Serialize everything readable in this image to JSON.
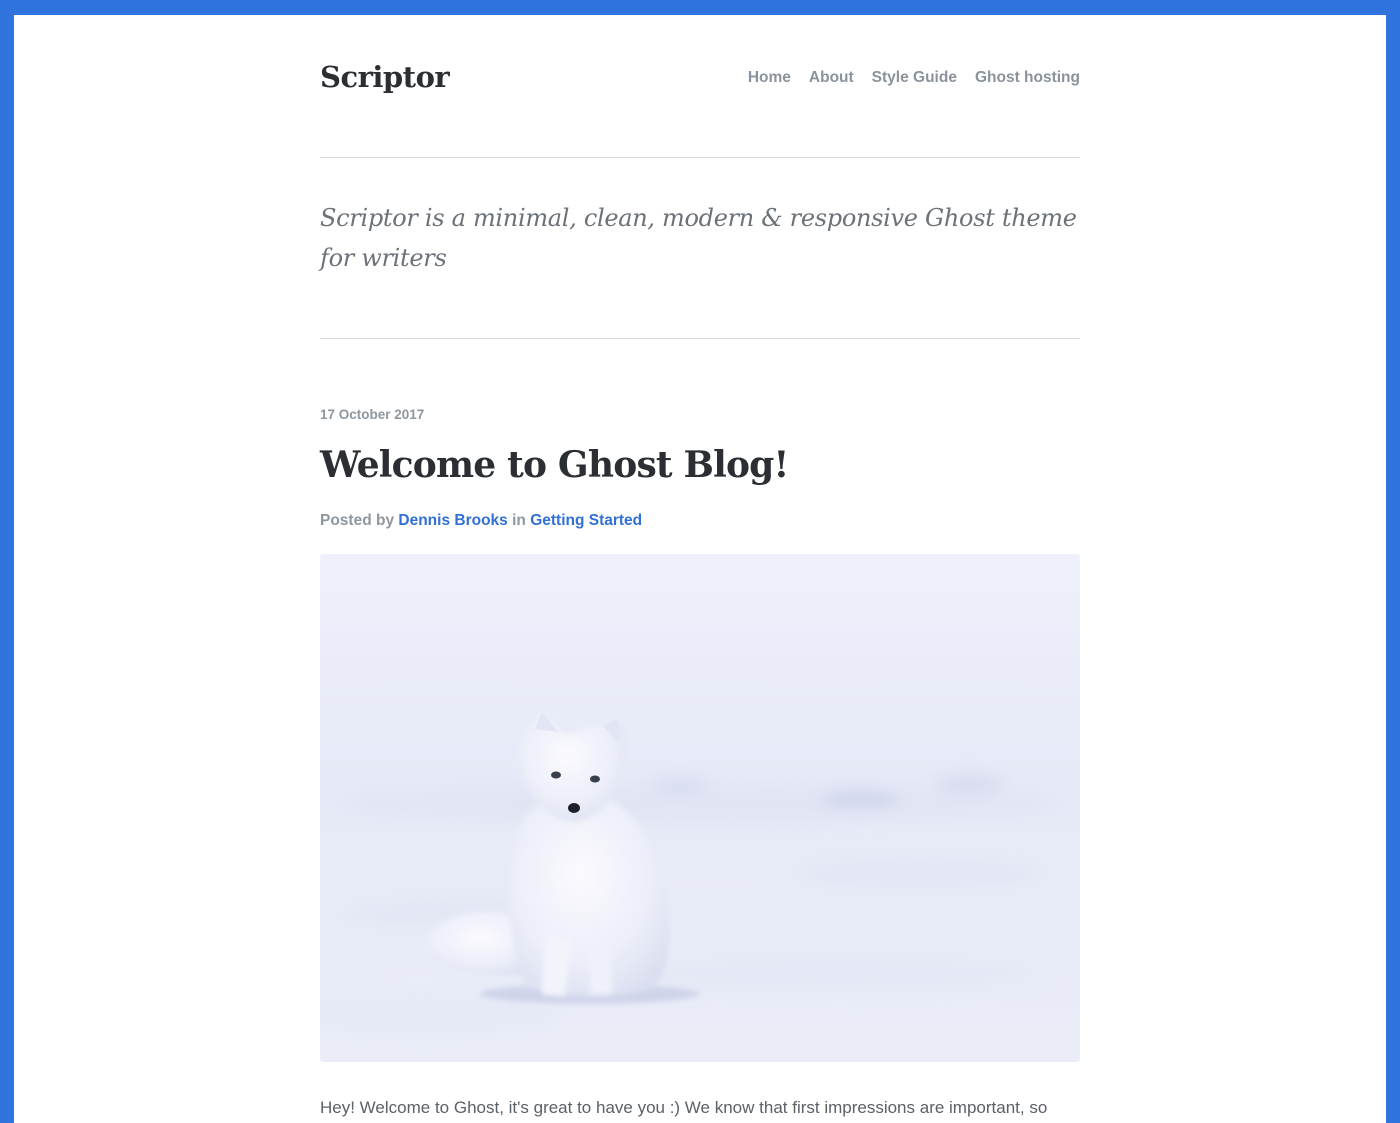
{
  "site": {
    "title": "Scriptor",
    "tagline": "Scriptor is a minimal, clean, modern & responsive Ghost theme for writers"
  },
  "nav": {
    "items": [
      {
        "label": "Home"
      },
      {
        "label": "About"
      },
      {
        "label": "Style Guide"
      },
      {
        "label": "Ghost hosting"
      }
    ]
  },
  "post": {
    "date": "17 October 2017",
    "title": "Welcome to Ghost Blog!",
    "meta": {
      "posted_by_label": "Posted by",
      "author": "Dennis Brooks",
      "in_label": "in",
      "category": "Getting Started"
    },
    "image_subject": "arctic fox sitting in snow",
    "excerpt": "Hey! Welcome to Ghost, it's great to have you :) We know that first impressions are important, so"
  },
  "colors": {
    "frame": "#3073dc",
    "link": "#3170d4",
    "heading": "#2b2f33",
    "muted": "#8f979e"
  }
}
